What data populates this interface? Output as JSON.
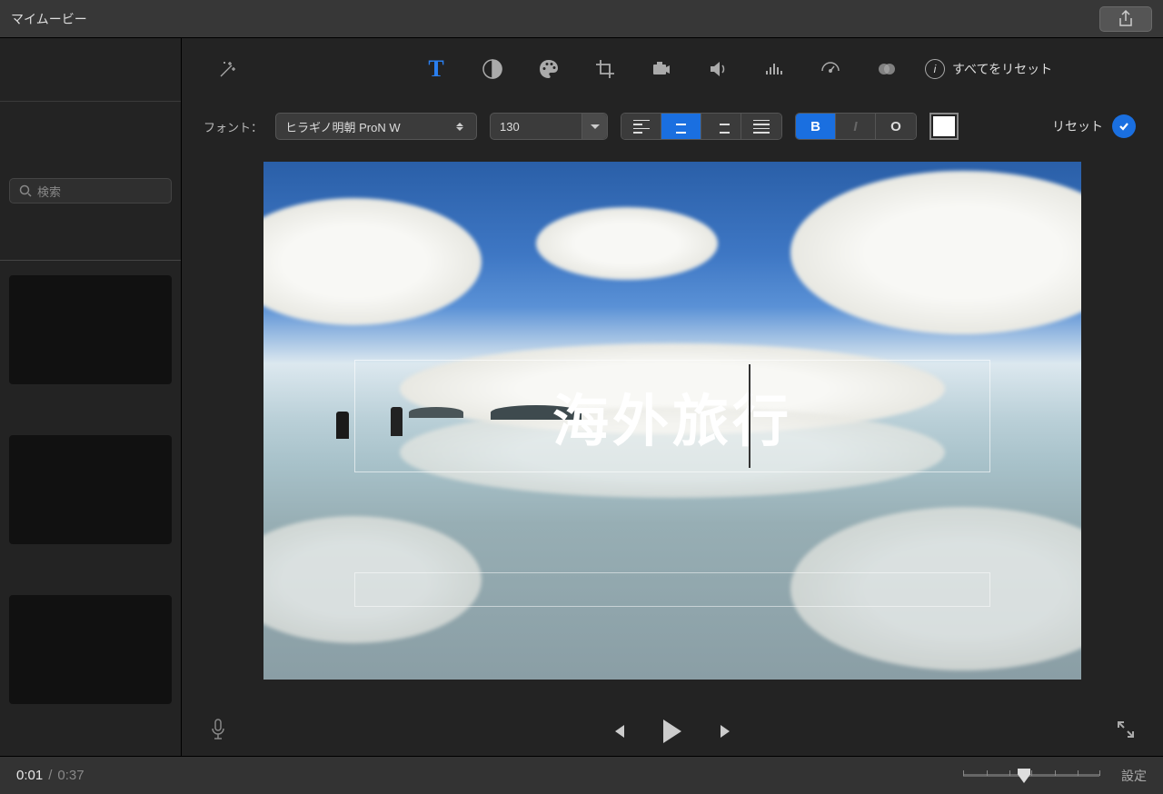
{
  "header": {
    "title": "マイムービー"
  },
  "sidebar": {
    "search_placeholder": "検索"
  },
  "toolbar": {
    "reset_all_label": "すべてをリセット"
  },
  "format": {
    "font_label": "フォント：",
    "font_value": "ヒラギノ明朝 ProN W",
    "size_value": "130",
    "bold": "B",
    "italic": "I",
    "outline": "O",
    "reset_label": "リセット",
    "text_color": "#FFFFFF"
  },
  "title_overlay": {
    "main_text": "海外旅行",
    "sub_text": ""
  },
  "playback": {
    "current_time": "0:01",
    "total_time": "0:37"
  },
  "footer": {
    "settings_label": "設定"
  }
}
